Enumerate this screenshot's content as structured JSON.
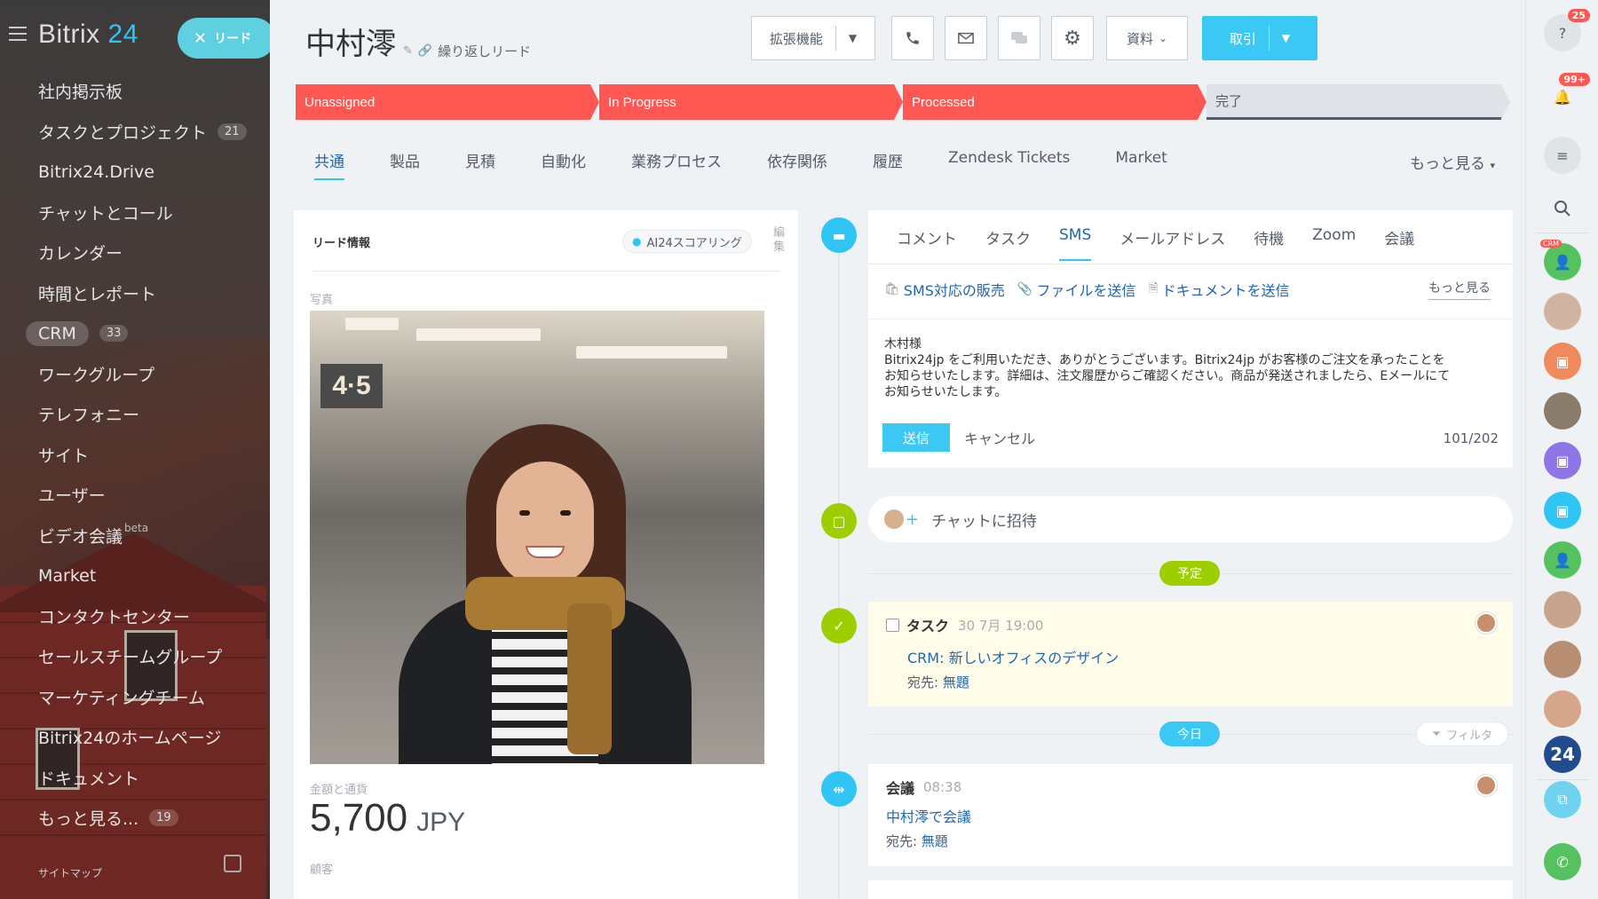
{
  "sidebar": {
    "logo_text": "Bitrix",
    "logo_num": "24",
    "lead_pill": "リード",
    "items": [
      {
        "label": "社内掲示板",
        "count": ""
      },
      {
        "label": "タスクとプロジェクト",
        "count": "21"
      },
      {
        "label": "Bitrix24.Drive",
        "count": ""
      },
      {
        "label": "チャットとコール",
        "count": ""
      },
      {
        "label": "カレンダー",
        "count": ""
      },
      {
        "label": "時間とレポート",
        "count": ""
      },
      {
        "label": "CRM",
        "count": "33"
      },
      {
        "label": "ワークグループ",
        "count": ""
      },
      {
        "label": "テレフォニー",
        "count": ""
      },
      {
        "label": "サイト",
        "count": ""
      },
      {
        "label": "ユーザー",
        "count": ""
      },
      {
        "label": "ビデオ会議",
        "sup": "beta",
        "count": ""
      },
      {
        "label": "Market",
        "count": ""
      },
      {
        "label": "コンタクトセンター",
        "count": ""
      },
      {
        "label": "セールスチームグループ",
        "count": ""
      },
      {
        "label": "マーケティングチーム",
        "count": ""
      },
      {
        "label": "Bitrix24のホームページ",
        "count": ""
      },
      {
        "label": "ドキュメント",
        "count": ""
      },
      {
        "label": "もっと見る...",
        "count": "19"
      }
    ],
    "footer": "サイトマップ"
  },
  "header": {
    "title": "中村澪",
    "repeat_lead": "繰り返しリード",
    "btn_extensions": "拡張機能",
    "btn_documents": "資料",
    "btn_deal": "取引"
  },
  "stages": [
    {
      "label": "Unassigned",
      "state": "done"
    },
    {
      "label": "In Progress",
      "state": "done"
    },
    {
      "label": "Processed",
      "state": "done"
    },
    {
      "label": "完了",
      "state": "todo"
    }
  ],
  "tabs": [
    "共通",
    "製品",
    "見積",
    "自動化",
    "業務プロセス",
    "依存関係",
    "履歴",
    "Zendesk Tickets",
    "Market"
  ],
  "tabs_more": "もっと見る",
  "lead_card": {
    "title": "リード情報",
    "ai_scoring": "AI24スコアリング",
    "edit": "編集",
    "photo_label": "写真",
    "amount_label": "金額と通貨",
    "amount": "5,700",
    "currency": "JPY",
    "client_label": "顧客"
  },
  "activity": {
    "tabs": [
      "コメント",
      "タスク",
      "SMS",
      "メールアドレス",
      "待機",
      "Zoom",
      "会議"
    ],
    "actions": [
      "SMS対応の販売",
      "ファイルを送信",
      "ドキュメントを送信"
    ],
    "actions_more": "もっと見る",
    "sms_text": "木村様\nBitrix24jp をご利用いただき、ありがとうございます。Bitrix24jp がお客様のご注文を承ったことをお知らせいたします。詳細は、注文履歴からご確認ください。商品が発送されましたら、Eメールにてお知らせいたします。",
    "send": "送信",
    "cancel": "キャンセル",
    "char_count": "101/202"
  },
  "timeline": {
    "invite": "チャットに招待",
    "planned": "予定",
    "today": "今日",
    "filter": "フィルタ",
    "task": {
      "title": "タスク",
      "time": "30 7月 19:00",
      "link": "CRM: 新しいオフィスのデザイン",
      "to_label": "宛先:",
      "to_value": "無題"
    },
    "meeting": {
      "title": "会議",
      "time": "08:38",
      "link": "中村澪で会議",
      "to_label": "宛先:",
      "to_value": "無題"
    }
  },
  "rail": {
    "help_badge": "25",
    "notif_badge": "99+",
    "crm_tag": "CRM",
    "b24_label": "24"
  }
}
